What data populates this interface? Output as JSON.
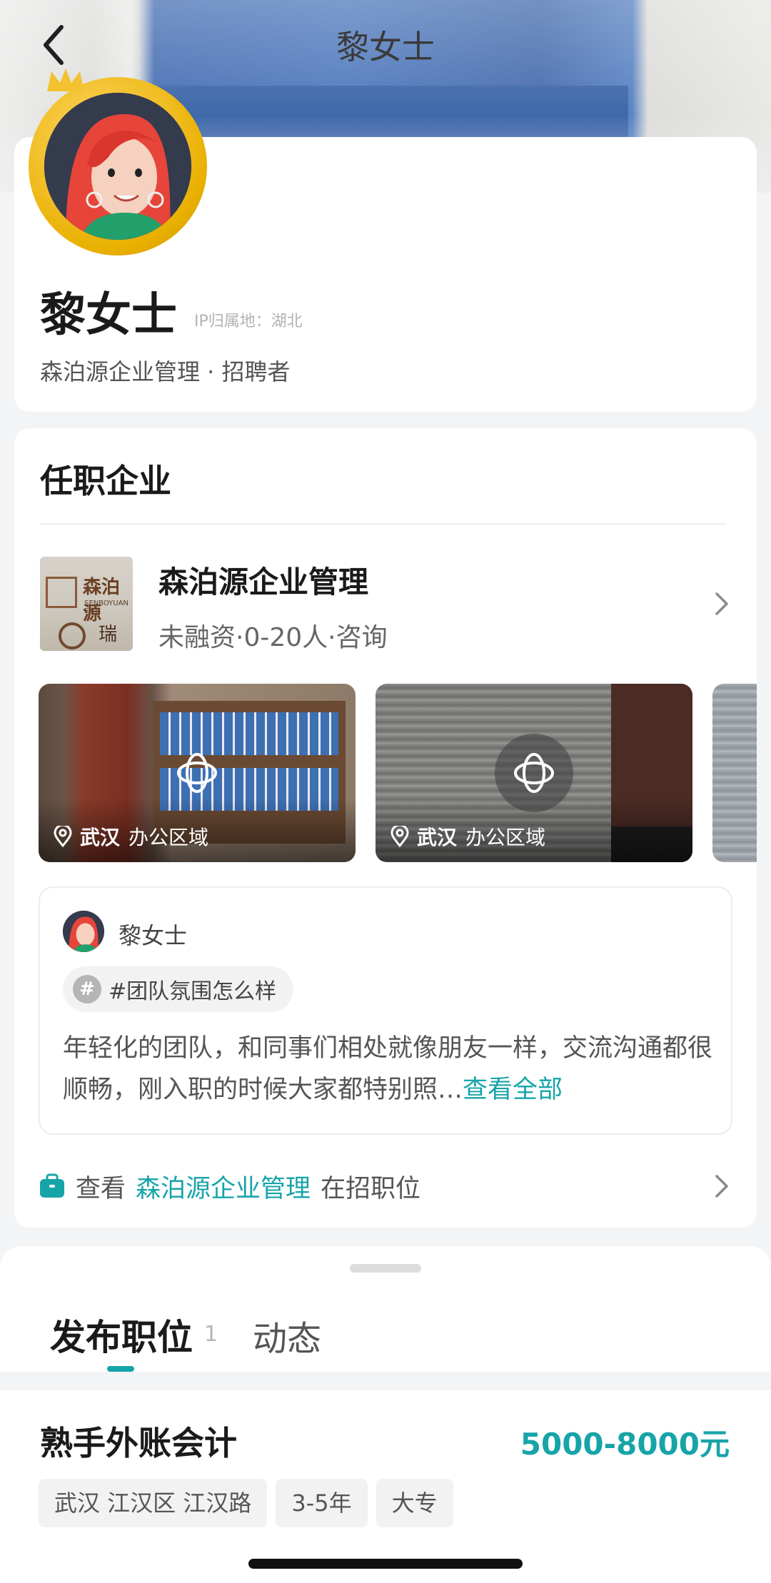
{
  "header": {
    "title": "黎女士"
  },
  "profile": {
    "name": "黎女士",
    "ip_location": "IP归属地：湖北",
    "subtitle": "森泊源企业管理 · 招聘者"
  },
  "company_section": {
    "title": "任职企业",
    "logo": {
      "line1": "森泊源",
      "line2": "SENBOYUAN ENT",
      "line3": "瑞云"
    },
    "name": "森泊源企业管理",
    "meta": "未融资·0-20人·咨询",
    "photos": [
      {
        "city": "武汉",
        "area": "办公区域"
      },
      {
        "city": "武汉",
        "area": "办公区域"
      }
    ]
  },
  "review": {
    "author": "黎女士",
    "tag": "#团队氛围怎么样",
    "tag_icon": "#",
    "text": "年轻化的团队，和同事们相处就像朋友一样，交流沟通都很顺畅，刚入职的时候大家都特别照…",
    "more": "查看全部"
  },
  "jobs_link": {
    "prefix": "查看",
    "company": "森泊源企业管理",
    "suffix": "在招职位"
  },
  "tabs": {
    "posted_label": "发布职位",
    "posted_count": "1",
    "activity_label": "动态",
    "active": "posted"
  },
  "job": {
    "title": "熟手外账会计",
    "salary": "5000-8000元",
    "tags": [
      "武汉 江汉区 江汉路",
      "3-5年",
      "大专"
    ]
  },
  "colors": {
    "accent": "#17a4a9",
    "avatar_frame": "#e9b000"
  }
}
